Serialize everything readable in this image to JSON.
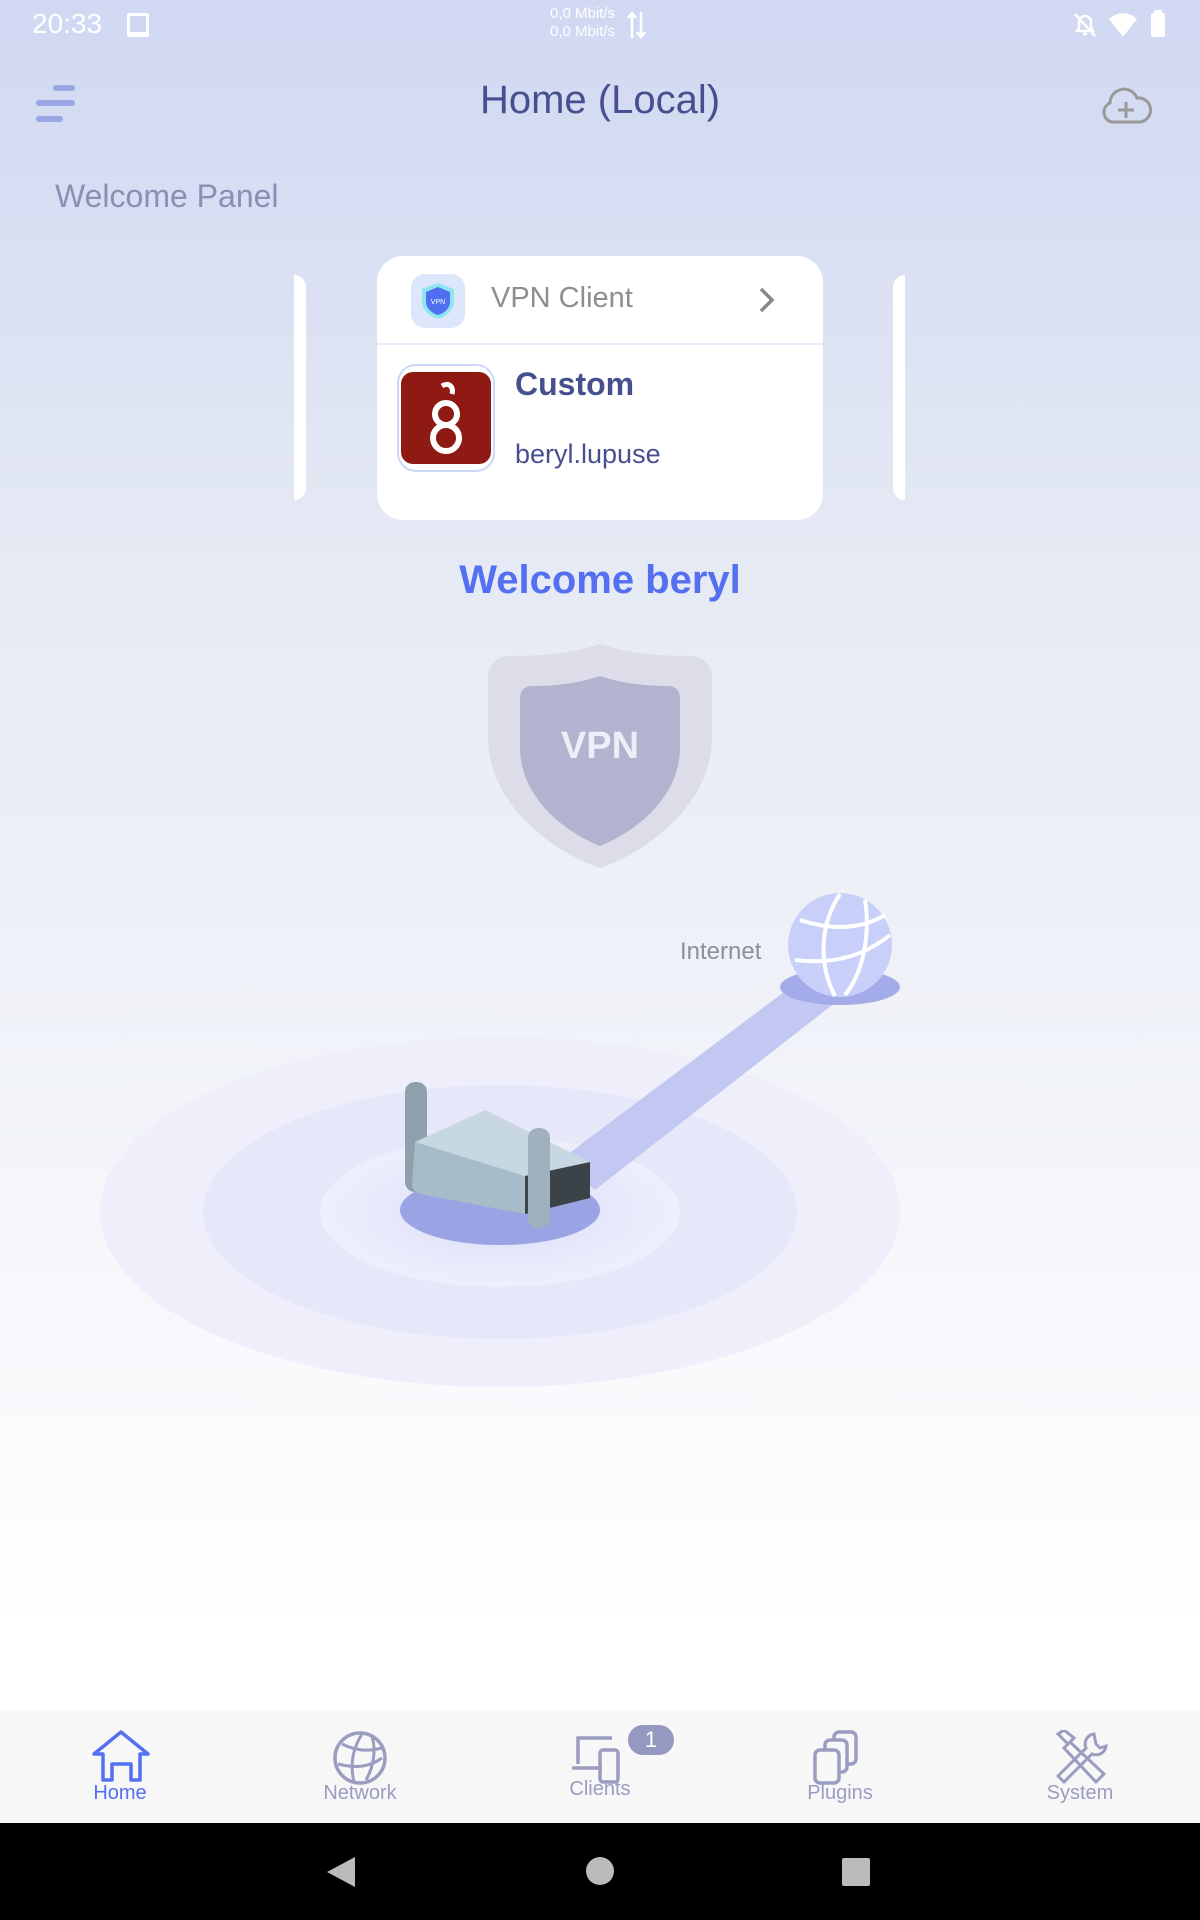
{
  "status_bar": {
    "time": "20:33",
    "upload": "0,0 Mbit/s",
    "download": "0,0 Mbit/s",
    "icons": [
      "screenshot-icon",
      "bell-off-icon",
      "wifi-icon",
      "battery-icon"
    ]
  },
  "header": {
    "title": "Home (Local)",
    "menu_icon": "menu-icon",
    "action_icon": "cloud-add-icon"
  },
  "section_title": "Welcome Panel",
  "vpn_card": {
    "title": "VPN Client",
    "protocol": "Custom",
    "server": "beryl.lupuse"
  },
  "welcome": "Welcome beryl",
  "shield_label": "VPN",
  "internet_label": "Internet",
  "bottom_nav": {
    "active": "Home",
    "items": [
      {
        "label": "Home",
        "icon": "home-icon"
      },
      {
        "label": "Network",
        "icon": "globe-icon"
      },
      {
        "label": "Clients",
        "icon": "devices-icon",
        "badge": "1"
      },
      {
        "label": "Plugins",
        "icon": "plugins-icon"
      },
      {
        "label": "System",
        "icon": "tools-icon"
      }
    ]
  },
  "colors": {
    "accent": "#5470f0",
    "title": "#46508f",
    "inactive": "#9a9cc0"
  }
}
